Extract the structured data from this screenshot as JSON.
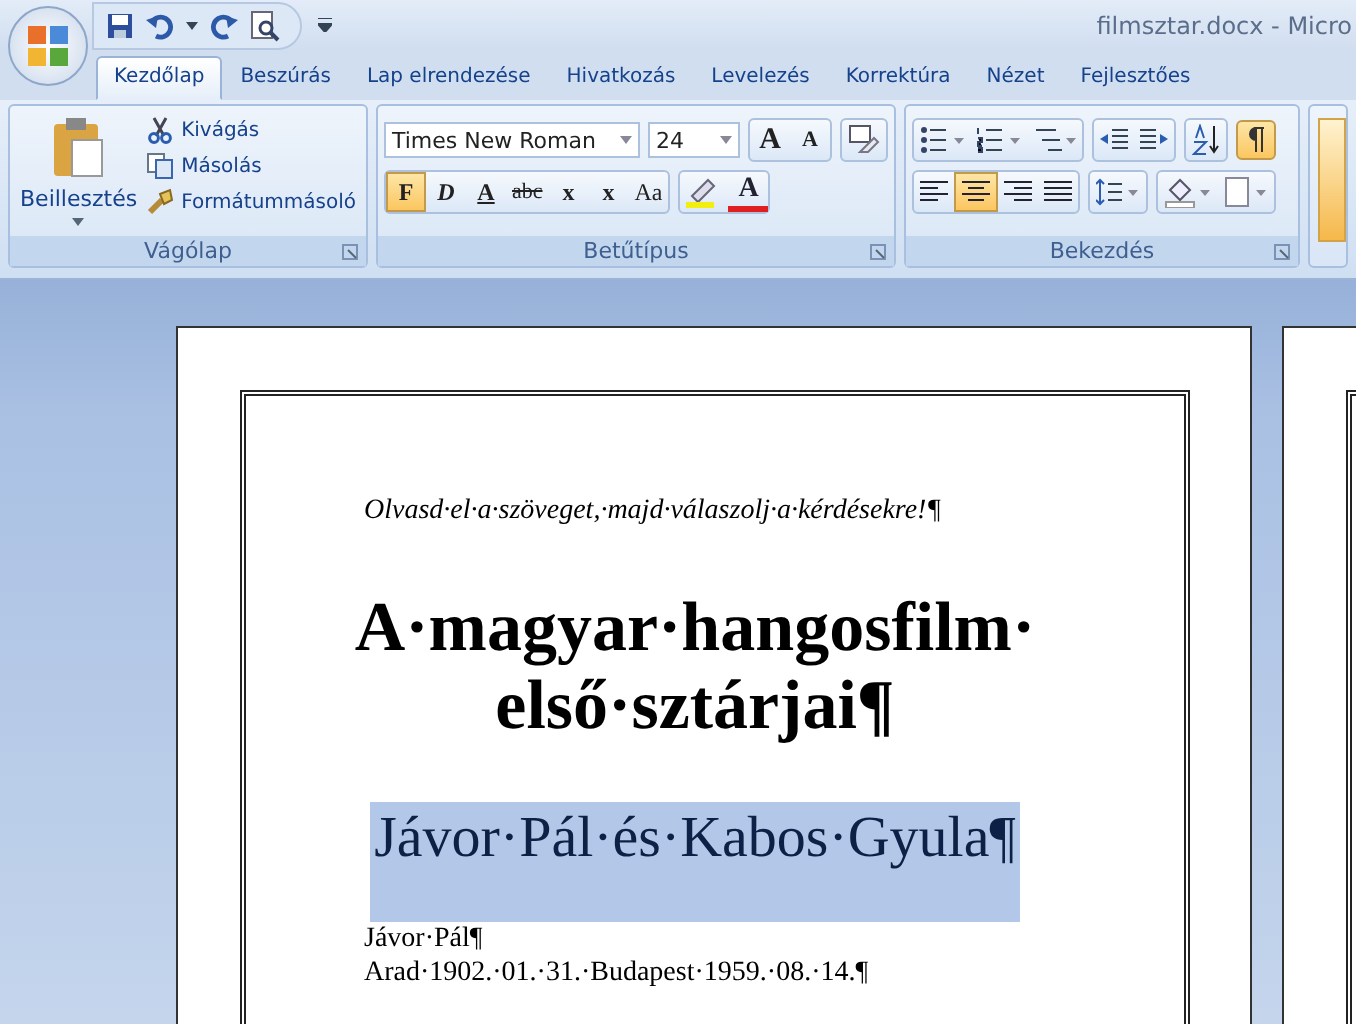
{
  "window": {
    "title": "filmsztar.docx - Micro"
  },
  "tabs": [
    {
      "label": "Kezdőlap",
      "selected": true
    },
    {
      "label": "Beszúrás",
      "selected": false
    },
    {
      "label": "Lap elrendezése",
      "selected": false
    },
    {
      "label": "Hivatkozás",
      "selected": false
    },
    {
      "label": "Levelezés",
      "selected": false
    },
    {
      "label": "Korrektúra",
      "selected": false
    },
    {
      "label": "Nézet",
      "selected": false
    },
    {
      "label": "Fejlesztőes",
      "selected": false
    }
  ],
  "clipboard": {
    "title": "Vágólap",
    "paste": "Beillesztés",
    "actions": [
      {
        "kind": "cut",
        "label": "Kivágás"
      },
      {
        "kind": "copy",
        "label": "Másolás"
      },
      {
        "kind": "painter",
        "label": "Formátummásoló"
      }
    ]
  },
  "font": {
    "title": "Betűtípus",
    "name": "Times New Roman",
    "size": "24",
    "sizers": [
      {
        "kind": "grow",
        "label": "A"
      },
      {
        "kind": "shrink",
        "label": "A"
      }
    ],
    "styles": [
      {
        "kind": "bold",
        "label": "F",
        "selected": true
      },
      {
        "kind": "italic",
        "label": "D",
        "selected": false
      },
      {
        "kind": "underline",
        "label": "A",
        "selected": false
      },
      {
        "kind": "strike",
        "label": "abc",
        "selected": false
      },
      {
        "kind": "sub",
        "label": "x",
        "selected": false
      },
      {
        "kind": "sup",
        "label": "x",
        "selected": false
      },
      {
        "kind": "case",
        "label": "Aa",
        "selected": false
      }
    ],
    "font_color": "A"
  },
  "paragraph": {
    "title": "Bekezdés",
    "show_marks": true,
    "aligns": [
      {
        "kind": "left",
        "selected": false
      },
      {
        "kind": "center",
        "selected": true
      },
      {
        "kind": "right",
        "selected": false
      },
      {
        "kind": "justify",
        "selected": false
      }
    ]
  },
  "document": {
    "instruction": "Olvasd·el·a·szöveget,·majd·válaszolj·a·kérdésekre!¶",
    "title_lines": [
      "A·magyar·hangosfilm·",
      "első·sztárjai¶"
    ],
    "subtitle": {
      "text": "Jávor·Pál·és·Kabos·Gyula¶",
      "selected": true
    },
    "body": [
      "Jávor·Pál¶",
      "Arad·1902.·01.·31.·Budapest·1959.·08.·14.¶"
    ]
  }
}
